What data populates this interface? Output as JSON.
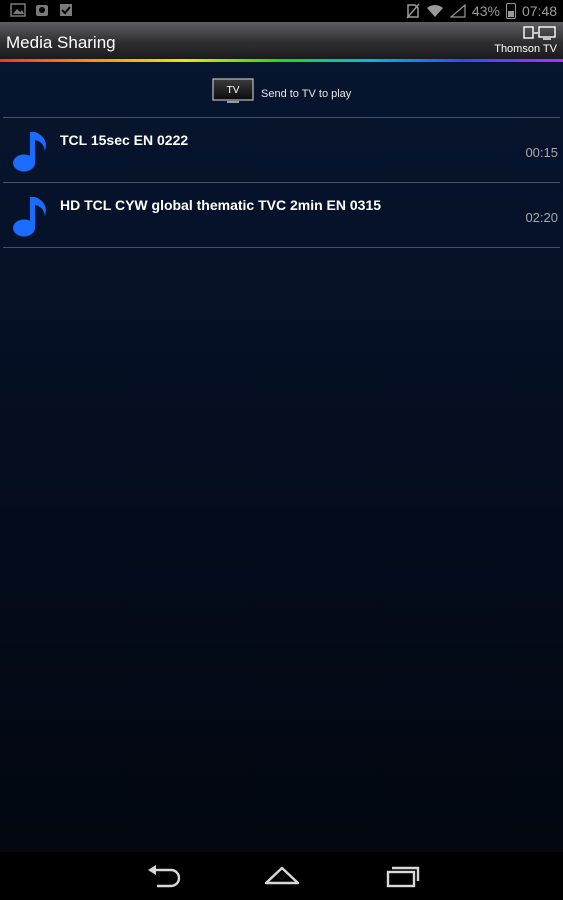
{
  "status_bar": {
    "battery": "43%",
    "time": "07:48",
    "left_icons": [
      "image-icon",
      "cloud-icon",
      "checkbox-icon"
    ]
  },
  "action_bar": {
    "title": "Media Sharing",
    "device_name": "Thomson TV"
  },
  "send_bar": {
    "tv_label": "TV",
    "label": "Send to TV to play"
  },
  "media_items": [
    {
      "title": "TCL 15sec EN 0222",
      "duration": "00:15"
    },
    {
      "title": "HD TCL CYW global thematic TVC 2min EN 0315",
      "duration": "02:20"
    }
  ],
  "colors": {
    "accent_blue": "#1a6cff",
    "background": "#06122a"
  }
}
